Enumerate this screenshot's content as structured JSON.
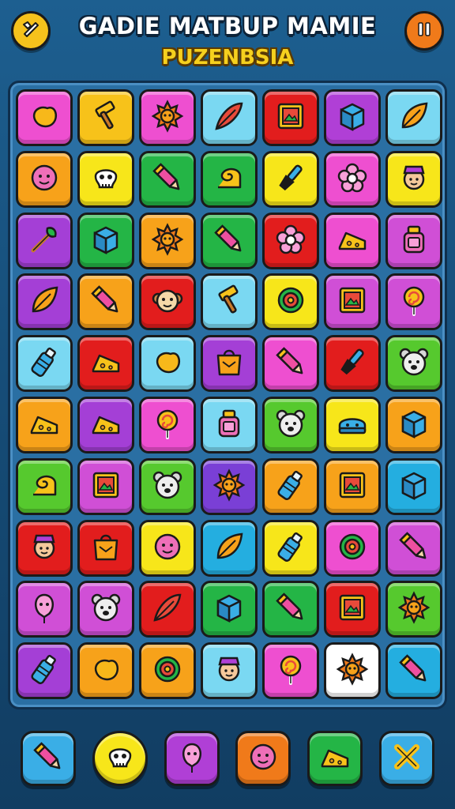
{
  "header": {
    "title": "GADIE MATBUP MAMIE",
    "subtitle": "PUZENBSIA",
    "left_button_icon": "tool-icon",
    "right_button_icon": "pause-icon",
    "left_button_color": "#f6c21c",
    "right_button_color": "#f07a1a"
  },
  "board": {
    "rows": 10,
    "cols": 7,
    "tiles": [
      {
        "color": "#ee4fd0",
        "icon": "blob-icon"
      },
      {
        "color": "#f7c21a",
        "icon": "hammer-icon"
      },
      {
        "color": "#ee4fd0",
        "icon": "sun-icon"
      },
      {
        "color": "#7ad8f2",
        "icon": "feather-icon"
      },
      {
        "color": "#e21d1d",
        "icon": "frame-icon"
      },
      {
        "color": "#b03fd6",
        "icon": "box-icon"
      },
      {
        "color": "#7ad8f2",
        "icon": "leaf-icon"
      },
      {
        "color": "#f7a21a",
        "icon": "face-icon"
      },
      {
        "color": "#f7e61a",
        "icon": "skull-icon"
      },
      {
        "color": "#24b546",
        "icon": "pencil-icon"
      },
      {
        "color": "#24b546",
        "icon": "swirl-icon"
      },
      {
        "color": "#f7e61a",
        "icon": "brush-icon"
      },
      {
        "color": "#ee4fd0",
        "icon": "flower-icon"
      },
      {
        "color": "#f7e61a",
        "icon": "person-icon"
      },
      {
        "color": "#a43fd6",
        "icon": "wand-icon"
      },
      {
        "color": "#24b546",
        "icon": "box-icon"
      },
      {
        "color": "#f7a21a",
        "icon": "sun-icon"
      },
      {
        "color": "#24b546",
        "icon": "pencil-icon"
      },
      {
        "color": "#e21d1d",
        "icon": "flower-icon"
      },
      {
        "color": "#ee4fd0",
        "icon": "cheese-icon"
      },
      {
        "color": "#d04fd6",
        "icon": "jar-icon"
      },
      {
        "color": "#a43fd6",
        "icon": "leaf-icon"
      },
      {
        "color": "#f7a21a",
        "icon": "pencil-icon"
      },
      {
        "color": "#e21d1d",
        "icon": "monkey-icon"
      },
      {
        "color": "#7ad8f2",
        "icon": "hammer-icon"
      },
      {
        "color": "#f7e61a",
        "icon": "target-icon"
      },
      {
        "color": "#d04fd6",
        "icon": "frame-icon"
      },
      {
        "color": "#d04fd6",
        "icon": "lollipop-icon"
      },
      {
        "color": "#7ad8f2",
        "icon": "bottle-icon"
      },
      {
        "color": "#e21d1d",
        "icon": "cheese-icon"
      },
      {
        "color": "#7ad8f2",
        "icon": "blob-icon"
      },
      {
        "color": "#a43fd6",
        "icon": "bag-icon"
      },
      {
        "color": "#ee4fd0",
        "icon": "pencil-icon"
      },
      {
        "color": "#e21d1d",
        "icon": "brush-icon"
      },
      {
        "color": "#56c92e",
        "icon": "bear-icon"
      },
      {
        "color": "#f7a21a",
        "icon": "cheese-icon"
      },
      {
        "color": "#a43fd6",
        "icon": "cheese-icon"
      },
      {
        "color": "#ee4fd0",
        "icon": "lollipop-icon"
      },
      {
        "color": "#7ad8f2",
        "icon": "jar-icon"
      },
      {
        "color": "#56c92e",
        "icon": "bear-icon"
      },
      {
        "color": "#f7e61a",
        "icon": "hat-icon"
      },
      {
        "color": "#f7a21a",
        "icon": "box-icon"
      },
      {
        "color": "#56c92e",
        "icon": "swirl-icon"
      },
      {
        "color": "#d04fd6",
        "icon": "frame-icon"
      },
      {
        "color": "#56c92e",
        "icon": "bear-icon"
      },
      {
        "color": "#7a3fd6",
        "icon": "sun-icon"
      },
      {
        "color": "#f7a21a",
        "icon": "bottle-icon"
      },
      {
        "color": "#f7a21a",
        "icon": "frame-icon"
      },
      {
        "color": "#24aee0",
        "icon": "box-icon"
      },
      {
        "color": "#e21d1d",
        "icon": "person-icon"
      },
      {
        "color": "#e21d1d",
        "icon": "bag-icon"
      },
      {
        "color": "#f7e61a",
        "icon": "face-icon"
      },
      {
        "color": "#24aee0",
        "icon": "leaf-icon"
      },
      {
        "color": "#f7e61a",
        "icon": "bottle-icon"
      },
      {
        "color": "#ee4fd0",
        "icon": "target-icon"
      },
      {
        "color": "#d04fd6",
        "icon": "pencil-icon"
      },
      {
        "color": "#d04fd6",
        "icon": "balloon-icon"
      },
      {
        "color": "#d04fd6",
        "icon": "bear-icon"
      },
      {
        "color": "#e21d1d",
        "icon": "feather-icon"
      },
      {
        "color": "#24b546",
        "icon": "box-icon"
      },
      {
        "color": "#24b546",
        "icon": "pencil-icon"
      },
      {
        "color": "#e21d1d",
        "icon": "frame-icon"
      },
      {
        "color": "#56c92e",
        "icon": "sun-icon"
      },
      {
        "color": "#a43fd6",
        "icon": "bottle-icon"
      },
      {
        "color": "#f7a21a",
        "icon": "blob-icon"
      },
      {
        "color": "#f7a21a",
        "icon": "target-icon"
      },
      {
        "color": "#7ad8f2",
        "icon": "person-icon"
      },
      {
        "color": "#ee4fd0",
        "icon": "lollipop-icon"
      },
      {
        "color": "#ffffff",
        "icon": "sun-icon"
      },
      {
        "color": "#24aee0",
        "icon": "pencil-icon"
      }
    ]
  },
  "powerups": [
    {
      "color": "#3aaee6",
      "icon": "pencil-icon"
    },
    {
      "color": "#f7e61a",
      "icon": "skull-icon"
    },
    {
      "color": "#b03fd6",
      "icon": "balloon-icon"
    },
    {
      "color": "#f07a1a",
      "icon": "face-icon"
    },
    {
      "color": "#24b546",
      "icon": "cheese-icon"
    },
    {
      "color": "#3aaee6",
      "icon": "close-icon"
    }
  ]
}
